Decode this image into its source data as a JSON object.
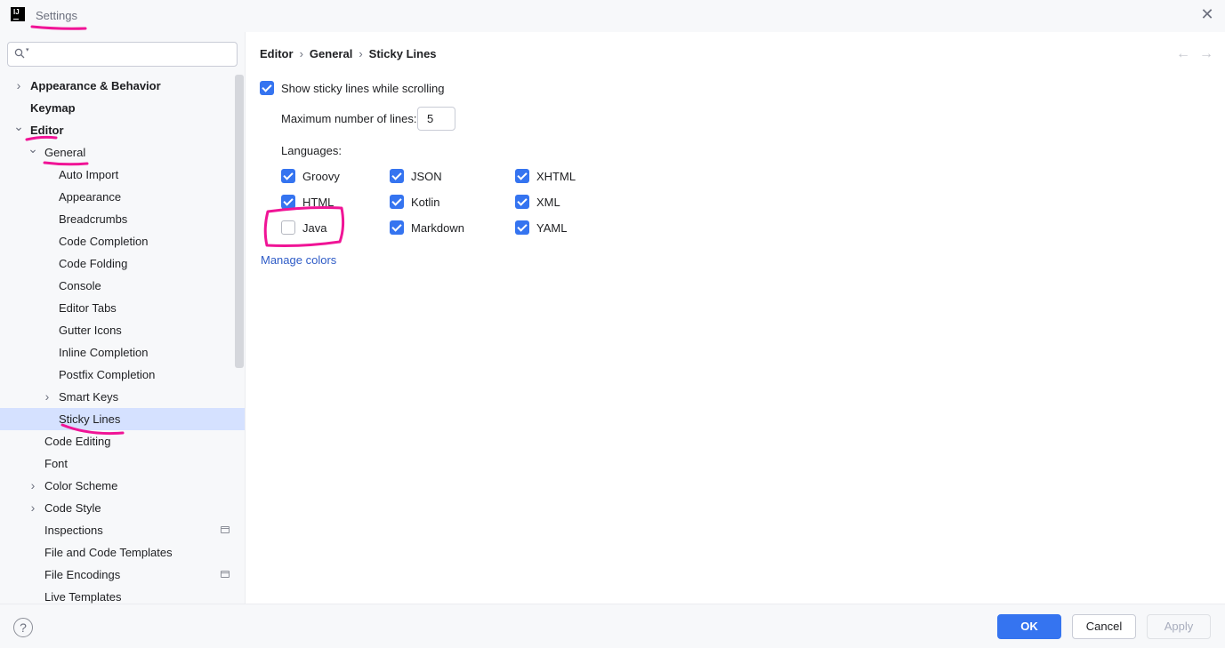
{
  "window": {
    "title": "Settings"
  },
  "search": {
    "placeholder": ""
  },
  "sidebar": {
    "items": [
      {
        "label": "Appearance & Behavior",
        "level": 0,
        "arrow": "right",
        "bold": true
      },
      {
        "label": "Keymap",
        "level": 0,
        "arrow": "",
        "bold": true
      },
      {
        "label": "Editor",
        "level": 0,
        "arrow": "down",
        "bold": true
      },
      {
        "label": "General",
        "level": 1,
        "arrow": "down",
        "bold": false
      },
      {
        "label": "Auto Import",
        "level": 2,
        "arrow": "",
        "bold": false
      },
      {
        "label": "Appearance",
        "level": 2,
        "arrow": "",
        "bold": false
      },
      {
        "label": "Breadcrumbs",
        "level": 2,
        "arrow": "",
        "bold": false
      },
      {
        "label": "Code Completion",
        "level": 2,
        "arrow": "",
        "bold": false
      },
      {
        "label": "Code Folding",
        "level": 2,
        "arrow": "",
        "bold": false
      },
      {
        "label": "Console",
        "level": 2,
        "arrow": "",
        "bold": false
      },
      {
        "label": "Editor Tabs",
        "level": 2,
        "arrow": "",
        "bold": false
      },
      {
        "label": "Gutter Icons",
        "level": 2,
        "arrow": "",
        "bold": false
      },
      {
        "label": "Inline Completion",
        "level": 2,
        "arrow": "",
        "bold": false
      },
      {
        "label": "Postfix Completion",
        "level": 2,
        "arrow": "",
        "bold": false
      },
      {
        "label": "Smart Keys",
        "level": 2,
        "arrow": "right",
        "bold": false
      },
      {
        "label": "Sticky Lines",
        "level": 2,
        "arrow": "",
        "bold": false,
        "selected": true
      },
      {
        "label": "Code Editing",
        "level": 1,
        "arrow": "",
        "bold": false
      },
      {
        "label": "Font",
        "level": 1,
        "arrow": "",
        "bold": false
      },
      {
        "label": "Color Scheme",
        "level": 1,
        "arrow": "right",
        "bold": false
      },
      {
        "label": "Code Style",
        "level": 1,
        "arrow": "right",
        "bold": false
      },
      {
        "label": "Inspections",
        "level": 1,
        "arrow": "",
        "bold": false,
        "badge": true
      },
      {
        "label": "File and Code Templates",
        "level": 1,
        "arrow": "",
        "bold": false
      },
      {
        "label": "File Encodings",
        "level": 1,
        "arrow": "",
        "bold": false,
        "badge": true
      },
      {
        "label": "Live Templates",
        "level": 1,
        "arrow": "",
        "bold": false
      }
    ]
  },
  "breadcrumb": [
    "Editor",
    "General",
    "Sticky Lines"
  ],
  "settings": {
    "show_sticky_label": "Show sticky lines while scrolling",
    "show_sticky_checked": true,
    "max_lines_label": "Maximum number of lines:",
    "max_lines_value": "5",
    "languages_label": "Languages:",
    "manage_colors": "Manage colors"
  },
  "languages": [
    {
      "name": "Groovy",
      "checked": true
    },
    {
      "name": "HTML",
      "checked": true
    },
    {
      "name": "Java",
      "checked": false
    },
    {
      "name": "JSON",
      "checked": true
    },
    {
      "name": "Kotlin",
      "checked": true
    },
    {
      "name": "Markdown",
      "checked": true
    },
    {
      "name": "XHTML",
      "checked": true
    },
    {
      "name": "XML",
      "checked": true
    },
    {
      "name": "YAML",
      "checked": true
    }
  ],
  "footer": {
    "help": "?",
    "ok": "OK",
    "cancel": "Cancel",
    "apply": "Apply"
  },
  "colors": {
    "accent": "#3574f0",
    "selection": "#d5e1ff",
    "annotation": "#f01496",
    "link": "#2f5cc7"
  }
}
